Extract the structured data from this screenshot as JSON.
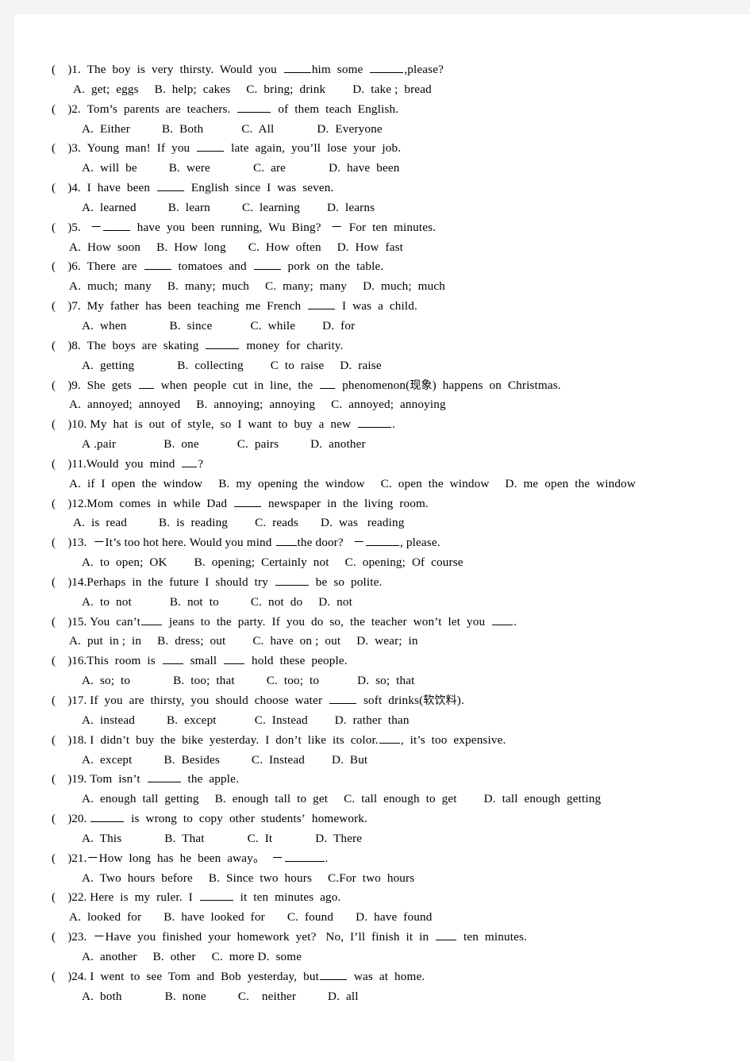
{
  "document": {
    "type": "english-grammar-multiple-choice-worksheet",
    "page_background": "#ffffff",
    "margin_background": "#f4f4f4",
    "text_color": "#000000"
  },
  "questions": [
    {
      "number": "1",
      "marker": "(    )1.",
      "stem_parts": [
        "The  boy  is  very  thirsty.  Would  you  ",
        "him  some  ",
        ",please?"
      ],
      "stem_plain": "(    )1.  The  boy  is  very  thirsty.  Would  you  ____him  some  _____,please?",
      "options": [
        "A.  get;  eggs",
        "B.  help;  cakes",
        "C.  bring;  drink",
        "D.  take ;  bread"
      ],
      "options_plain": "A.  get;  eggs        B.  help;  cakes       C.  bring;  drink          D.  take ;  bread"
    },
    {
      "number": "2",
      "marker": "(    )2.",
      "stem_parts": [
        "Tom’s  parents  are  teachers.  ",
        "  of  them  teach  English."
      ],
      "stem_plain": "(    )2.  Tom’s  parents  are  teachers.  _____  of  them  teach  English.",
      "options": [
        "A.  Either",
        "B.  Both",
        "C.  All",
        "D.  Everyone"
      ],
      "options_plain": "A.  Either             B.  Both            C.  All              D.  Everyone"
    },
    {
      "number": "3",
      "marker": "(    )3.",
      "stem_parts": [
        "Young  man!  If  you  ",
        "  late  again,  you’ll  lose  your  job."
      ],
      "stem_plain": "(    )3.  Young  man!  If  you  ____  late  again,  you’ll  lose  your  job.",
      "options": [
        "A.  will  be",
        "B.  were",
        "C.  are",
        "D.  have  been"
      ],
      "options_plain": "A.  will  be           B.  were             C.  are              D.  have  been"
    },
    {
      "number": "4",
      "marker": "(    )4.",
      "stem_parts": [
        "I  have  been  ",
        "  English  since  I  was  seven."
      ],
      "stem_plain": "(    )4.  I  have  been  ____  English  since  I  was  seven.",
      "options": [
        "A.  learned",
        "B.  learn",
        "C.  learning",
        "D.  learns"
      ],
      "options_plain": "A.  learned           B.  learn            C.  learning        D.  learns"
    },
    {
      "number": "5",
      "marker": "(    )5.",
      "stem_parts": [
        "－",
        "  have  you  been  running,  Wu  Bing?    －  For  ten  minutes."
      ],
      "stem_plain": "(    )5.   －____  have  you  been  running,  Wu  Bing?    －  For  ten  minutes.",
      "options": [
        "A.  How  soon",
        "B.  How  long",
        "C.  How  often",
        "D.  How  fast"
      ],
      "options_plain": "A.  How  soon        B.  How  long        C.  How  often       D.  How  fast"
    },
    {
      "number": "6",
      "marker": "(    )6.",
      "stem_parts": [
        "There  are  ",
        "  tomatoes  and  ",
        "  pork  on  the  table."
      ],
      "stem_plain": "(    )6.  There  are  ____  tomatoes  and  ____  pork  on  the  table.",
      "options": [
        "A.  much;  many",
        "B.  many;  much",
        "C.  many;  many",
        "D.  much;  much"
      ],
      "options_plain": "A.  much;  many       B.  many;  much      C.  many;  many     D.  much;  much"
    },
    {
      "number": "7",
      "marker": "(    )7.",
      "stem_parts": [
        "My  father  has  been  teaching  me  French  ",
        "  I  was  a  child."
      ],
      "stem_plain": "(    )7.  My  father  has  been  teaching  me  French  ____  I  was  a  child.",
      "options": [
        "A.  when",
        "B.  since",
        "C.  while",
        "D.  for"
      ],
      "options_plain": "A.  when              B.  since            C.  while           D.  for"
    },
    {
      "number": "8",
      "marker": "(    )8.",
      "stem_parts": [
        "The  boys  are  skating  ",
        "  money  for  charity."
      ],
      "stem_plain": "(    )8.  The  boys  are  skating  ____  money  for  charity.",
      "options": [
        "A.  getting",
        "B.  collecting",
        "C  to  raise",
        "D.  raise"
      ],
      "options_plain": "A.  getting           B.  collecting       C  to  raise       D.  raise"
    },
    {
      "number": "9",
      "marker": "(    )9.",
      "stem_parts": [
        "She  gets  ",
        "  when  people  cut  in  line,  the  ",
        "  phenomenon(",
        "现象",
        ")  happens  on  Christmas."
      ],
      "stem_plain": "(    )9.  She  gets  __  when  people  cut  in  line,  the  __  phenomenon(现象)  happens  on  Christmas.",
      "options": [
        "A.  annoyed;  annoyed",
        "B.  annoying;  annoying",
        "C.  annoyed;  annoying"
      ],
      "options_plain": "A.  annoyed;  annoyed     B.  annoying;  annoying     C.  annoyed;  annoying"
    },
    {
      "number": "10",
      "marker": "(    )10.",
      "stem_parts": [
        "My  hat  is  out  of  style,  so  I  want  to  buy  a  new  ",
        "."
      ],
      "stem_plain": "(    )10.  My  hat  is  out  of  style,  so  I  want  to  buy  a  new  _____.",
      "options": [
        "A .pair",
        "B.  one",
        "C.  pairs",
        "D.  another"
      ],
      "options_plain": "A .pair               B.  one              C.  pairs           D.  another"
    },
    {
      "number": "11",
      "marker": "(    )11.",
      "stem_parts": [
        "Would  you  mind  ",
        "?"
      ],
      "stem_plain": "(    )11.Would  you  mind  __?",
      "options": [
        "A.  if  I  open  the  window",
        "B.  my  opening  the  window",
        "C.  open  the  window",
        "D.  me  open  the  window"
      ],
      "options_plain": "A.  if  I  open  the  window     B.  my  opening  the  window     C.  open  the  window    D.  me  open  the  window"
    },
    {
      "number": "12",
      "marker": "(    )12.",
      "stem_parts": [
        "Mom  comes  in  while  Dad  ",
        "  newspaper  in  the  living  room."
      ],
      "stem_plain": "(    )12.Mom  comes  in  while  Dad  ____  newspaper  in  the  living  room.",
      "options": [
        "A.  is  read",
        "B.  is  reading",
        "C.  reads",
        "D.  was    reading"
      ],
      "options_plain": "A.  is  read          B.  is  reading      C.  reads        D.  was    reading"
    },
    {
      "number": "13",
      "marker": "(    )13.",
      "stem_parts": [
        "－It’s  too  hot  here.  Would  you  mind  ",
        "the  door?    －",
        ",  please."
      ],
      "stem_plain": "(    )13.   －It’s  too  hot  here.  Would  you  mind  ___the  door?    －_____,  please.",
      "options": [
        "A.  to  open;  OK",
        "B.  opening;  Certainly  not",
        "C.  opening;  Of  course"
      ],
      "options_plain": "A.  to  open;  OK       B.  opening;  Certainly  not      C.  opening;  Of  course"
    },
    {
      "number": "14",
      "marker": "(    )14.",
      "stem_parts": [
        "Perhaps  in  the  future  I  should  try  ",
        "  be  so  polite."
      ],
      "stem_plain": "(    )14.Perhaps  in  the  future  I  should  try  _____  be  so  polite.",
      "options": [
        "A.  to  not",
        "B.  not  to",
        "C.  not  do",
        "D.  not"
      ],
      "options_plain": "A.  to  not           B.  not  to          C.  not  do      D.  not"
    },
    {
      "number": "15",
      "marker": "(    )15.",
      "stem_parts": [
        "You  can’t",
        "  jeans  to  the  party.  If  you  do  so,  the  teacher  won’t  let  you  ",
        "."
      ],
      "stem_plain": "(    )15.  You  can’t___  jeans  to  the  party.  If  you  do  so,  the  teacher  won’t  let  you  ___.",
      "options": [
        "A.  put  in ;  in",
        "B.  dress;  out",
        "C.  have  on ;  out",
        "D.  wear;  in"
      ],
      "options_plain": "A.  put  in ;  in     B.  dress;  out       C.  have  on ;  out   D.  wear;  in"
    },
    {
      "number": "16",
      "marker": "(    )16.",
      "stem_parts": [
        "This  room  is  ",
        "  small  ",
        "  hold  these  people."
      ],
      "stem_plain": "(    )16.This  room  is  ___  small  ___  hold  these  people.",
      "options": [
        "A.  so;  to",
        "B.  too;  that",
        "C.  too;  to",
        "D.  so;  that"
      ],
      "options_plain": "A.  so;  to           B.  too;  that       C.  too;  to         D.  so;  that"
    },
    {
      "number": "17",
      "marker": "(    )17.",
      "stem_parts": [
        "If  you  are  thirsty,  you  should  choose  water  ",
        "  soft  drinks(",
        "软饮料",
        ")."
      ],
      "stem_plain": "(    )17.  If  you  are  thirsty,  you  should  choose  water  ____  soft  drinks(软饮料).",
      "options": [
        "A.  instead",
        "B.  except",
        "C.  Instead",
        "D.  rather  than"
      ],
      "options_plain": "A.  instead          B.  except           C.  Instead       D.  rather  than"
    },
    {
      "number": "18",
      "marker": "(    )18.",
      "stem_parts": [
        "I  didn’t  buy  the  bike  yesterday.  I  don’t  like  its  color.",
        ",  it’s  too  expensive."
      ],
      "stem_plain": "(    )18.  I  didn’t  buy  the  bike  yesterday.  I  don’t  like  its  color.___,  it’s  too  expensive.",
      "options": [
        "A.  except",
        "B.  Besides",
        "C.  Instead",
        "D.  But"
      ],
      "options_plain": "A.  except           B.  Besides          C.  Instead       D.  But"
    },
    {
      "number": "19",
      "marker": "(    )19.",
      "stem_parts": [
        "Tom  isn’t  ",
        "  the  apple."
      ],
      "stem_plain": "(    )19.  Tom  isn’t  _____  the  apple.",
      "options": [
        "A.  enough  tall  getting",
        "B.  enough  tall  to  get",
        "C.  tall  enough  to  get",
        "D.  tall  enough  getting"
      ],
      "options_plain": "A.  enough  tall  getting     B.  enough  tall  to  get     C.  tall  enough  to  get      D.  tall  enough  getting"
    },
    {
      "number": "20",
      "marker": "(    )20.",
      "stem_parts": [
        "",
        "  is  wrong  to  copy  other  students’  homework."
      ],
      "stem_plain": "(    )20.  _____  is  wrong  to  copy  other  students’  homework.",
      "options": [
        "A.  This",
        "B.  That",
        "C.  It",
        "D.  There"
      ],
      "options_plain": "A.  This             B.  That             C.  It             D.  There"
    },
    {
      "number": "21",
      "marker": "(    )21.",
      "stem_parts": [
        "－How  long  has  he  been  away。  －",
        "."
      ],
      "stem_plain": "(    )21.－How  long  has  he  been  away。  －_______.",
      "options": [
        "A.  Two  hours  before",
        "B.  Since  two  hours",
        "C.For  two  hours"
      ],
      "options_plain": "A.  Two  hours  before     B.  Since  two  hours    C.For  two  hours"
    },
    {
      "number": "22",
      "marker": "(    )22.",
      "stem_parts": [
        "Here  is  my  ruler.  I  ",
        "  it  ten  minutes  ago."
      ],
      "stem_plain": "(    )22.  Here  is  my  ruler.  I  _____  it  ten  minutes  ago.",
      "options": [
        "A.  looked  for",
        "B.  have  looked  for",
        "C.  found",
        "D.  have  found"
      ],
      "options_plain": "A.  looked  for      B.  have  looked  for     C.  found      D.  have  found"
    },
    {
      "number": "23",
      "marker": "(    )23.",
      "stem_parts": [
        "－Have  you  finished  your  homework  yet?    No,  I’ll  finish  it  in  ",
        "  ten  minutes."
      ],
      "stem_plain": "(    )23.  －Have  you  finished  your  homework  yet?    No,  I’ll  finish  it  in  ___  ten  minutes.",
      "options": [
        "A.  another",
        "B.  other",
        "C.  more D.  some"
      ],
      "options_plain": "A.  another    B.  other    C.  more D.  some"
    },
    {
      "number": "24",
      "marker": "(    )24.",
      "stem_parts": [
        "I  went  to  see  Tom  and  Bob  yesterday,  but",
        "  was  at  home."
      ],
      "stem_plain": "(    )24.  I  went  to  see  Tom  and  Bob  yesterday,  but____  was  at  home.",
      "options": [
        "A.  both",
        "B.  none",
        "C.    neither",
        "D.  all"
      ],
      "options_plain": "A.  both             B.  none           C.    neither        D.  all"
    }
  ]
}
